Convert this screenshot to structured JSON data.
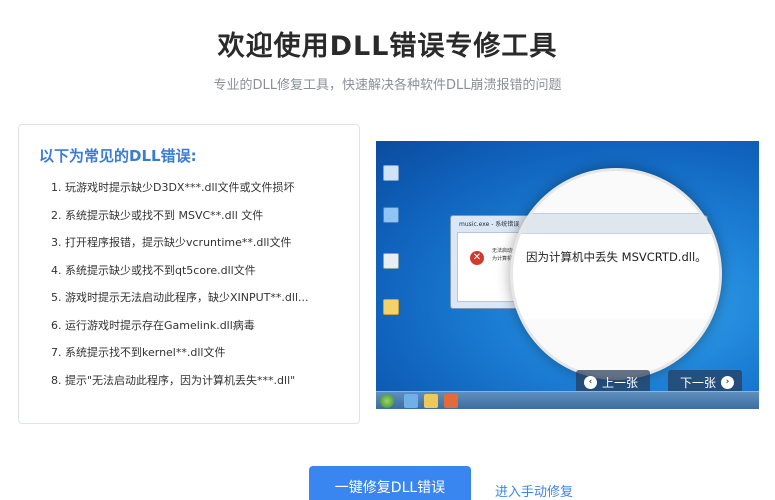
{
  "header": {
    "title": "欢迎使用DLL错误专修工具",
    "subtitle": "专业的DLL修复工具，快速解决各种软件DLL崩溃报错的问题"
  },
  "errors_card": {
    "title": "以下为常见的DLL错误:",
    "items": [
      "1. 玩游戏时提示缺少D3DX***.dll文件或文件损坏",
      "2. 系统提示缺少或找不到 MSVC**.dll 文件",
      "3. 打开程序报错，提示缺少vcruntime**.dll文件",
      "4. 系统提示缺少或找不到qt5core.dll文件",
      "5. 游戏时提示无法启动此程序，缺少XINPUT**.dll...",
      "6. 运行游戏时提示存在Gamelink.dll病毒",
      "7. 系统提示找不到kernel**.dll文件",
      "8. 提示\"无法启动此程序，因为计算机丢失***.dll\""
    ]
  },
  "screenshot": {
    "dialog_title": "music.exe - 系统错误",
    "dialog_text": "无法启动此程序因为计算机",
    "magnified_text": "因为计算机中丢失 MSVCRTD.dll。",
    "prev_label": "上一张",
    "next_label": "下一张",
    "prev_icon": "chevron-left-icon",
    "next_icon": "chevron-right-icon"
  },
  "actions": {
    "primary_label": "一键修复DLL错误",
    "manual_link": "进入手动修复"
  },
  "colors": {
    "accent": "#3a86f0",
    "card_title": "#3a7bd5",
    "error_red": "#d23a2d"
  }
}
